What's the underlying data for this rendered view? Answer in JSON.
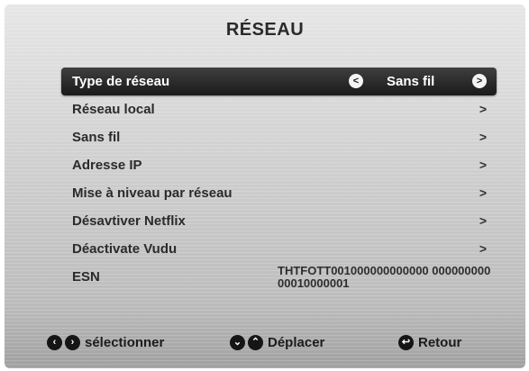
{
  "title": "RÉSEAU",
  "menu": {
    "selected": {
      "label": "Type de réseau",
      "value": "Sans fil",
      "left_arrow": "<",
      "right_arrow": ">"
    },
    "items": [
      {
        "label": "Réseau local",
        "chevron": ">"
      },
      {
        "label": "Sans fil",
        "chevron": ">"
      },
      {
        "label": "Adresse IP",
        "chevron": ">"
      },
      {
        "label": "Mise à niveau par réseau",
        "chevron": ">"
      },
      {
        "label": "Désavtiver Netflix",
        "chevron": ">"
      },
      {
        "label": "Déactivate Vudu",
        "chevron": ">"
      }
    ],
    "esn": {
      "label": "ESN",
      "value": "THTFOTT001000000000000 00000000000010000001"
    }
  },
  "footer": {
    "select_label": "sélectionner",
    "move_label": "Déplacer",
    "back_label": "Retour",
    "icons": {
      "left": "‹",
      "right": "›",
      "down": "⌄",
      "up": "⌃",
      "back": "↩"
    }
  }
}
